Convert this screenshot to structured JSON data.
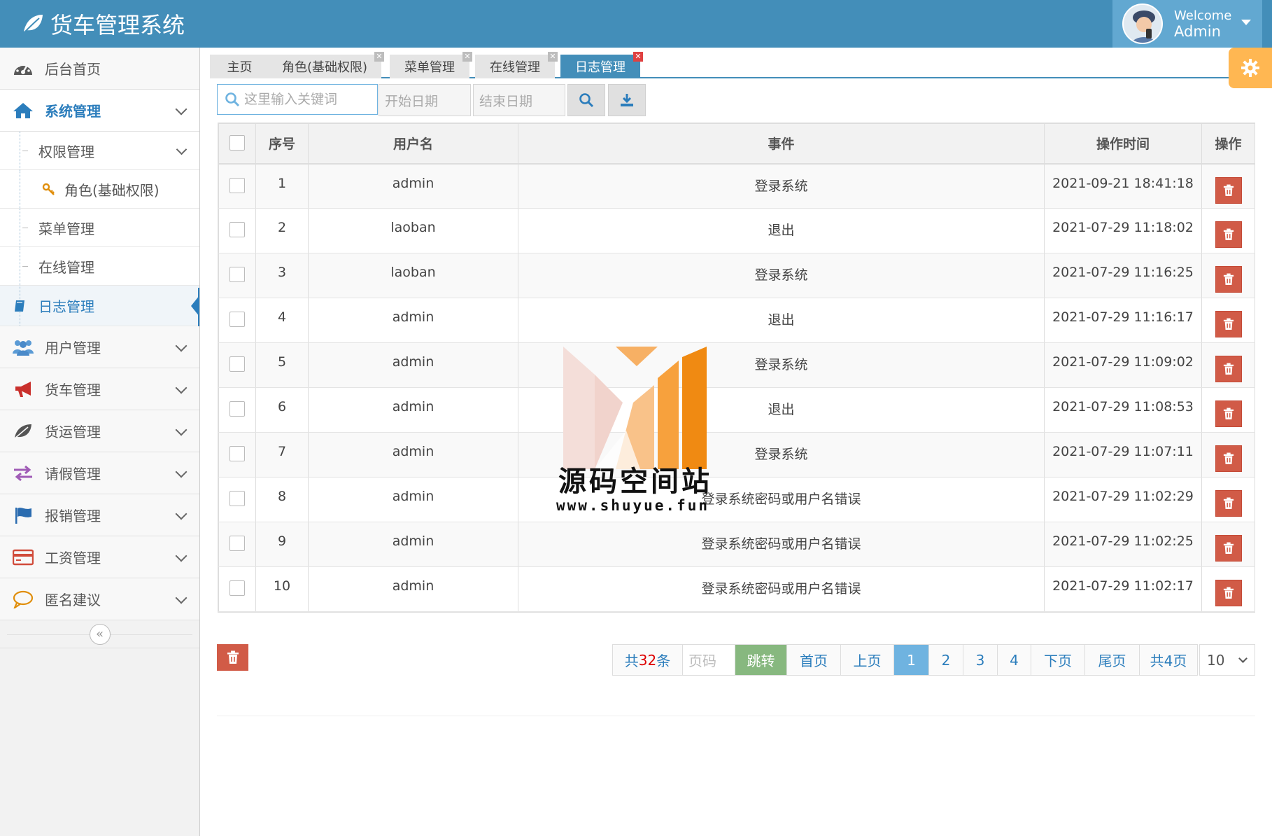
{
  "header": {
    "title": "货车管理系统",
    "welcome": "Welcome",
    "user": "Admin"
  },
  "sidebar": {
    "items": [
      {
        "label": "后台首页",
        "icon": "dashboard-icon"
      },
      {
        "label": "系统管理",
        "icon": "home-icon"
      },
      {
        "label": "用户管理",
        "icon": "users-icon"
      },
      {
        "label": "货车管理",
        "icon": "bullhorn-icon"
      },
      {
        "label": "货运管理",
        "icon": "leaf-icon"
      },
      {
        "label": "请假管理",
        "icon": "exchange-icon"
      },
      {
        "label": "报销管理",
        "icon": "flag-icon"
      },
      {
        "label": "工资管理",
        "icon": "credit-card-icon"
      },
      {
        "label": "匿名建议",
        "icon": "comment-icon"
      }
    ],
    "sub": {
      "permission": "权限管理",
      "role": "角色(基础权限)",
      "menu": "菜单管理",
      "online": "在线管理",
      "log": "日志管理"
    },
    "collapse_glyph": "«"
  },
  "tabs": [
    {
      "label": "主页",
      "closable": false
    },
    {
      "label": "角色(基础权限)",
      "closable": true
    },
    {
      "label": "菜单管理",
      "closable": true
    },
    {
      "label": "在线管理",
      "closable": true
    },
    {
      "label": "日志管理",
      "closable": true,
      "active": true
    }
  ],
  "toolbar": {
    "search_placeholder": "这里输入关键词",
    "start_date_placeholder": "开始日期",
    "end_date_placeholder": "结束日期"
  },
  "table": {
    "columns": [
      "序号",
      "用户名",
      "事件",
      "操作时间",
      "操作"
    ],
    "rows": [
      {
        "no": "1",
        "user": "admin",
        "event": "登录系统",
        "time": "2021-09-21 18:41:18"
      },
      {
        "no": "2",
        "user": "laoban",
        "event": "退出",
        "time": "2021-07-29 11:18:02"
      },
      {
        "no": "3",
        "user": "laoban",
        "event": "登录系统",
        "time": "2021-07-29 11:16:25"
      },
      {
        "no": "4",
        "user": "admin",
        "event": "退出",
        "time": "2021-07-29 11:16:17"
      },
      {
        "no": "5",
        "user": "admin",
        "event": "登录系统",
        "time": "2021-07-29 11:09:02"
      },
      {
        "no": "6",
        "user": "admin",
        "event": "退出",
        "time": "2021-07-29 11:08:53"
      },
      {
        "no": "7",
        "user": "admin",
        "event": "登录系统",
        "time": "2021-07-29 11:07:11"
      },
      {
        "no": "8",
        "user": "admin",
        "event": "登录系统密码或用户名错误",
        "time": "2021-07-29 11:02:29"
      },
      {
        "no": "9",
        "user": "admin",
        "event": "登录系统密码或用户名错误",
        "time": "2021-07-29 11:02:25"
      },
      {
        "no": "10",
        "user": "admin",
        "event": "登录系统密码或用户名错误",
        "time": "2021-07-29 11:02:17"
      }
    ]
  },
  "pager": {
    "total_prefix": "共",
    "total_count": "32",
    "total_suffix": "条",
    "jump_placeholder": "页码",
    "jump_label": "跳转",
    "first": "首页",
    "prev": "上页",
    "pages": [
      "1",
      "2",
      "3",
      "4"
    ],
    "current": "1",
    "next": "下页",
    "last": "尾页",
    "page_total": "共4页",
    "page_size": "10"
  },
  "watermark": {
    "title": "源码空间站",
    "url": "www.shuyue.fun"
  },
  "colors": {
    "header": "#438eb9",
    "accent": "#2b7dbc",
    "danger": "#d15b47",
    "go": "#87b87f",
    "settings": "#ffb752"
  }
}
